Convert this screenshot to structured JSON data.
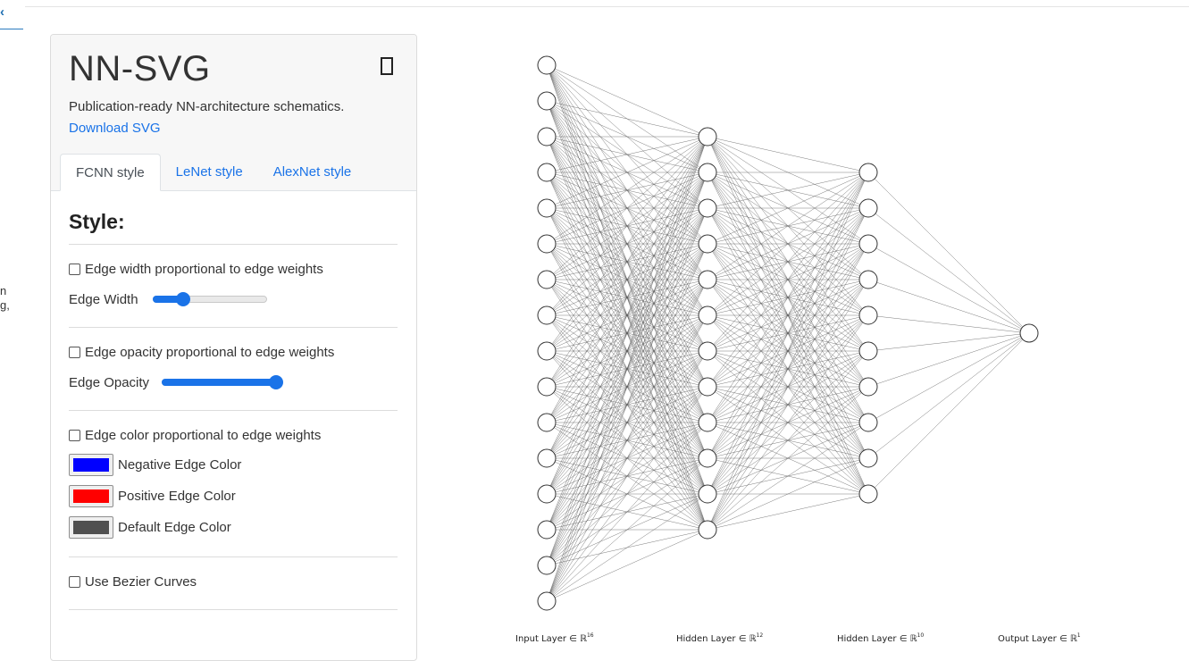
{
  "app": {
    "title": "NN-SVG",
    "tagline": "Publication-ready NN-architecture schematics.",
    "download_label": "Download SVG"
  },
  "tabs": [
    {
      "label": "FCNN style",
      "active": true
    },
    {
      "label": "LeNet style",
      "active": false
    },
    {
      "label": "AlexNet style",
      "active": false
    }
  ],
  "left_edge_text": [
    "n",
    "g,"
  ],
  "style": {
    "heading": "Style:",
    "edge_width": {
      "checkbox_label": "Edge width proportional to edge weights",
      "checked": false,
      "slider_label": "Edge Width",
      "value": 0.27
    },
    "edge_opacity": {
      "checkbox_label": "Edge opacity proportional to edge weights",
      "checked": false,
      "slider_label": "Edge Opacity",
      "value": 1.0
    },
    "edge_color": {
      "checkbox_label": "Edge color proportional to edge weights",
      "checked": false,
      "negative": {
        "label": "Negative Edge Color",
        "color": "#0000ff"
      },
      "positive": {
        "label": "Positive Edge Color",
        "color": "#ff0000"
      },
      "default": {
        "label": "Default Edge Color",
        "color": "#505050"
      }
    },
    "bezier": {
      "checkbox_label": "Use Bezier Curves",
      "checked": false
    }
  },
  "network": {
    "layers": [
      {
        "size": 16,
        "label": "Input Layer ∈ ℝ",
        "sup": "16"
      },
      {
        "size": 12,
        "label": "Hidden Layer ∈ ℝ",
        "sup": "12"
      },
      {
        "size": 10,
        "label": "Hidden Layer ∈ ℝ",
        "sup": "10"
      },
      {
        "size": 1,
        "label": "Output Layer ∈ ℝ",
        "sup": "1"
      }
    ],
    "edge_color": "#505050",
    "node_stroke": "#333333"
  }
}
